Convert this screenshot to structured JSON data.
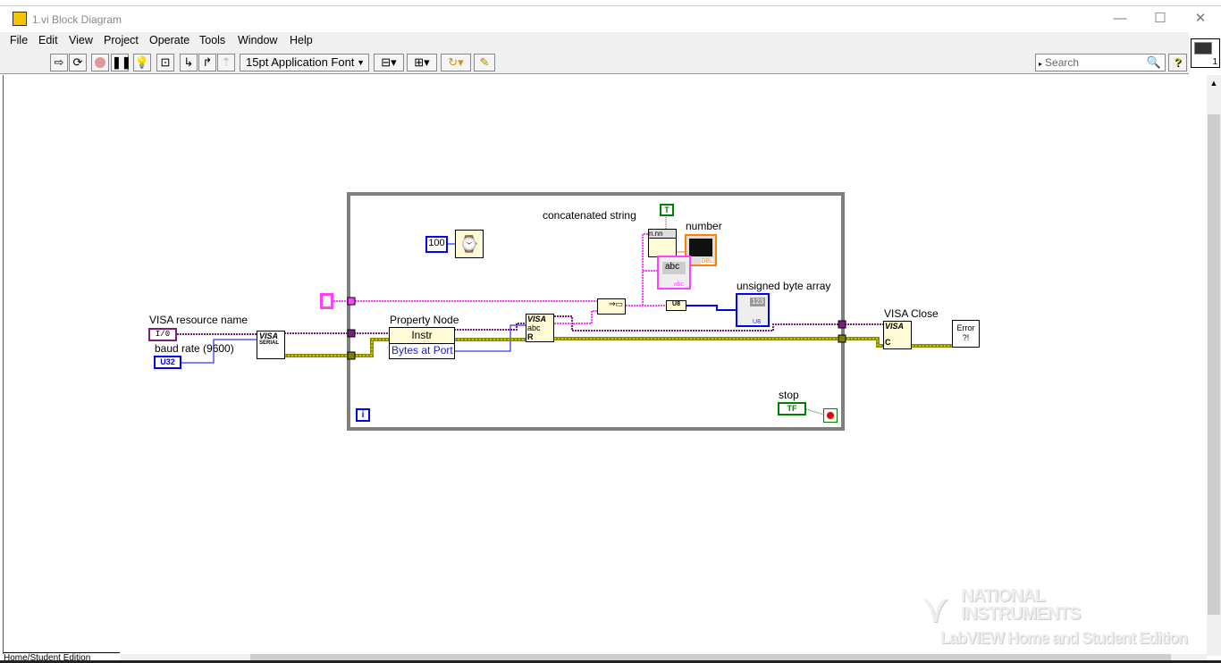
{
  "window": {
    "title": "1.vi Block Diagram",
    "minimize": "—",
    "maximize": "☐",
    "close": "✕"
  },
  "menu": [
    "File",
    "Edit",
    "View",
    "Project",
    "Operate",
    "Tools",
    "Window",
    "Help"
  ],
  "toolbar": {
    "font": "15pt Application Font",
    "search_placeholder": "Search",
    "help": "?",
    "connector_pane_num": "1"
  },
  "diagram": {
    "visa_resource_label": "VISA resource name",
    "visa_resource_const": "I/0",
    "baud_label": "baud rate (9600)",
    "baud_const": "U32",
    "visa_serial": "VISA",
    "visa_serial_sub": "SERIAL",
    "wait_const": "100",
    "property_node_label": "Property Node",
    "property_class": "Instr",
    "property_item": "Bytes at Port",
    "visa_read": "VISA",
    "visa_read_sub": "abc",
    "visa_read_r": "R",
    "concat_label": "concatenated string",
    "true_const": "T",
    "number_label": "number",
    "dbl": "DBL",
    "str_ind": "abc",
    "str_type": "abc",
    "fmt": "n.nn",
    "u8_conv": "U8",
    "uba_label": "unsigned byte array",
    "arr_num": "123",
    "arr_type": "U8",
    "visa_close_label": "VISA Close",
    "visa_close": "VISA",
    "visa_close_c": "C",
    "error_handler": "Error ?!",
    "stop_label": "stop",
    "stop_tf": "TF",
    "iter": "i"
  },
  "watermark": {
    "line1": "NATIONAL",
    "line2": "INSTRUMENTS",
    "line3": "LabVIEW Home and Student Edition"
  },
  "status": {
    "edition": "Home/Student Edition"
  },
  "colors": {
    "loop": "#808080",
    "refnum": "#7b1f7b",
    "string": "#ff40ff",
    "error": "#c8c800",
    "numeric": "#0000ff",
    "boolean": "#008000"
  }
}
